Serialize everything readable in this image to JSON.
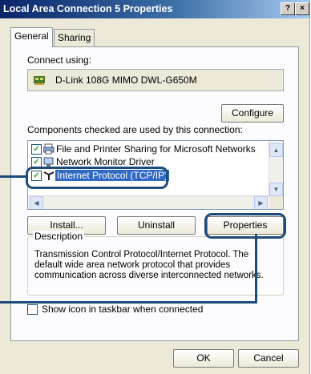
{
  "window": {
    "title": "Local Area Connection 5 Properties",
    "help_btn": "?",
    "close_btn": "×"
  },
  "tabs": [
    {
      "label": "General"
    },
    {
      "label": "Sharing"
    }
  ],
  "connect": {
    "label": "Connect using:",
    "adapter": "D-Link 108G MIMO DWL-G650M",
    "configure_btn": "Configure"
  },
  "components": {
    "label": "Components checked are used by this connection:",
    "items": [
      {
        "label": "File and Printer Sharing for Microsoft Networks",
        "checked": true
      },
      {
        "label": "Network Monitor Driver",
        "checked": true
      },
      {
        "label": "Internet Protocol (TCP/IP)",
        "checked": true,
        "selected": true
      }
    ]
  },
  "buttons": {
    "install": "Install...",
    "uninstall": "Uninstall",
    "properties": "Properties"
  },
  "description": {
    "legend": "Description",
    "text": "Transmission Control Protocol/Internet Protocol. The default wide area network protocol that provides communication across diverse interconnected networks."
  },
  "show_icon_label": "Show icon in taskbar when connected",
  "footer": {
    "ok": "OK",
    "cancel": "Cancel"
  },
  "colors": {
    "highlight_outline": "#1d4b7a",
    "selection": "#316ac5",
    "titlebar": "#0a246a"
  }
}
